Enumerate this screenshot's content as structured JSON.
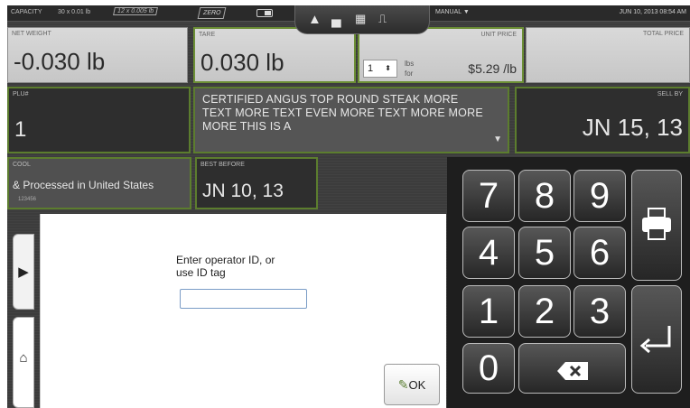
{
  "status": {
    "capacity_label": "CAPACITY",
    "capacity1": "30 x 0.01 lb",
    "capacity2": "12 x 0.005 lb",
    "zero": "ZERO",
    "mode": "MANUAL",
    "datetime": "JUN 10, 2013 08:54 AM",
    "icons": [
      "toggle-icon",
      "warning-icon",
      "printer-icon",
      "grid-icon",
      "network-icon"
    ]
  },
  "weights": {
    "net_weight_label": "NET WEIGHT",
    "net_weight": "-0.030 lb",
    "tare_label": "TARE",
    "tare": "0.030 lb",
    "unit_price_label": "UNIT PRICE",
    "qty": "1",
    "per_unit_top": "lbs",
    "per_unit_bottom": "for",
    "unit_price": "$5.29 /lb",
    "total_price_label": "TOTAL PRICE"
  },
  "product": {
    "plu_label": "PLU#",
    "plu": "1",
    "description": "CERTIFIED ANGUS TOP ROUND STEAK MORE TEXT MORE TEXT EVEN MORE TEXT MORE MORE MORE THIS IS A",
    "sell_by_label": "SELL BY",
    "sell_by": "JN 15, 13",
    "cool_label": "COOL",
    "cool_text": "& Processed in United States",
    "cool_code": "123456",
    "best_before_label": "BEST BEFORE",
    "best_before": "JN 10, 13"
  },
  "keypad": {
    "k7": "7",
    "k8": "8",
    "k9": "9",
    "k4": "4",
    "k5": "5",
    "k6": "6",
    "k1": "1",
    "k2": "2",
    "k3": "3",
    "k0": "0"
  },
  "dialog": {
    "prompt_line1": "Enter operator ID, or",
    "prompt_line2": "use ID tag",
    "input_value": "",
    "ok_label": "OK"
  }
}
